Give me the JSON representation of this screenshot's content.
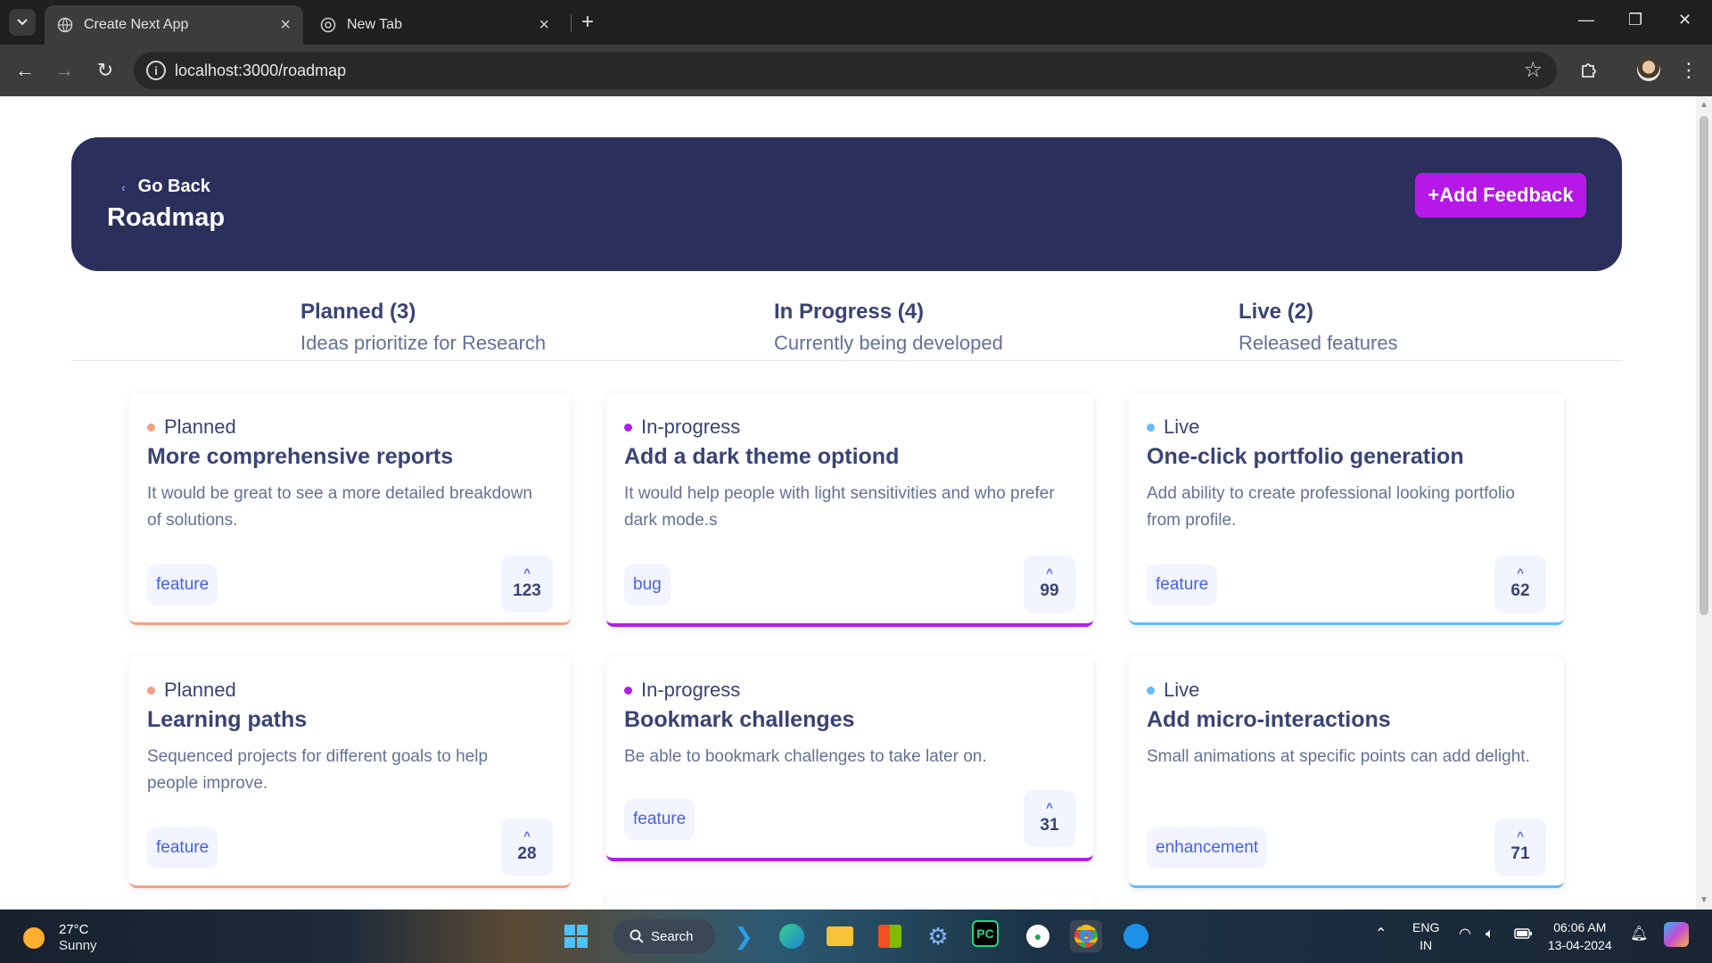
{
  "browser": {
    "tabs": [
      {
        "title": "Create Next App",
        "active": true
      },
      {
        "title": "New Tab",
        "active": false
      }
    ],
    "url": "localhost:3000/roadmap"
  },
  "header": {
    "back_label": "Go Back",
    "title": "Roadmap",
    "add_feedback_label": "+Add Feedback"
  },
  "columns": [
    {
      "title": "Planned (3)",
      "subtitle": "Ideas prioritize for Research",
      "color": "#f49f85"
    },
    {
      "title": "In Progress (4)",
      "subtitle": "Currently being developed",
      "color": "#ad1fea"
    },
    {
      "title": "Live (2)",
      "subtitle": "Released features",
      "color": "#62bcfa"
    }
  ],
  "cards": [
    {
      "status": "Planned",
      "title": "More comprehensive reports",
      "description": "It would be great to see a more detailed breakdown of solutions.",
      "tag": "feature",
      "votes": "123"
    },
    {
      "status": "In-progress",
      "title": "Add a dark theme optiond",
      "description": "It would help people with light sensitivities and who prefer dark mode.s",
      "tag": "bug",
      "votes": "99"
    },
    {
      "status": "Live",
      "title": "One-click portfolio generation",
      "description": "Add ability to create professional looking portfolio from profile.",
      "tag": "feature",
      "votes": "62"
    },
    {
      "status": "Planned",
      "title": "Learning paths",
      "description": "Sequenced projects for different goals to help people improve.",
      "tag": "feature",
      "votes": "28"
    },
    {
      "status": "In-progress",
      "title": "Bookmark challenges",
      "description": "Be able to bookmark challenges to take later on.",
      "tag": "feature",
      "votes": "31"
    },
    {
      "status": "Live",
      "title": "Add micro-interactions",
      "description": "Small animations at specific points can add delight.",
      "tag": "enhancement",
      "votes": "71"
    }
  ],
  "taskbar": {
    "temperature": "27°C",
    "weather": "Sunny",
    "search_label": "Search",
    "language": "ENG",
    "region": "IN",
    "time": "06:06 AM",
    "date": "13-04-2024"
  },
  "colors": {
    "header_bg": "#2a2f5b",
    "accent": "#b618e8",
    "planned": "#f49f85",
    "in_progress": "#ad1fea",
    "live": "#62bcfa"
  }
}
